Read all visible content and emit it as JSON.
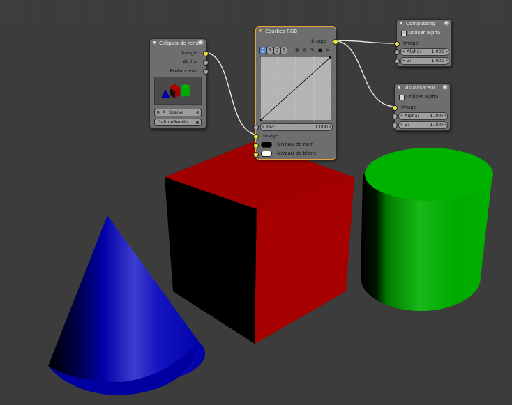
{
  "render_layers": {
    "title": "Calques de rendu",
    "outputs": [
      "Image",
      "Alpha",
      "Profondeur"
    ],
    "scene_label": "Scene",
    "layer_label": "CalqueRendu"
  },
  "rgb_curves": {
    "title": "Courbes RGB",
    "output_label": "Image",
    "channel_buttons": [
      "C",
      "R",
      "G",
      "B"
    ],
    "tool_icons": [
      "zoom-in-icon",
      "zoom-out-icon",
      "wrench-icon",
      "point-icon",
      "close-icon"
    ],
    "fac_label": "Fac:",
    "fac_value": "1.000",
    "inputs": [
      "Image",
      "Niveau de noir",
      "Niveau de blanc"
    ],
    "black_level_color": "#000000",
    "white_level_color": "#ffffff"
  },
  "composite": {
    "title": "Composting",
    "use_alpha_label": "Utiliser alpha",
    "use_alpha_checked": true,
    "input_label": "Image",
    "alpha_label": "Alpha:",
    "alpha_value": "1.000",
    "z_label": "Z:",
    "z_value": "1.000"
  },
  "viewer": {
    "title": "Visualisateur",
    "use_alpha_label": "Utiliser alpha",
    "use_alpha_checked": false,
    "input_label": "Image",
    "alpha_label": "Alpha:",
    "alpha_value": "1.000",
    "z_label": "Z:",
    "z_value": "1.000"
  },
  "colors": {
    "background": "#3c3c3c",
    "node_body": "#6e6e6e",
    "selected_outline": "#e8a33a",
    "socket_color": "#e6e23a",
    "socket_value": "#a3a3a3",
    "cube_red": "#a50000",
    "cone_blue": "#0000b4",
    "cylinder_green": "#00b400"
  }
}
